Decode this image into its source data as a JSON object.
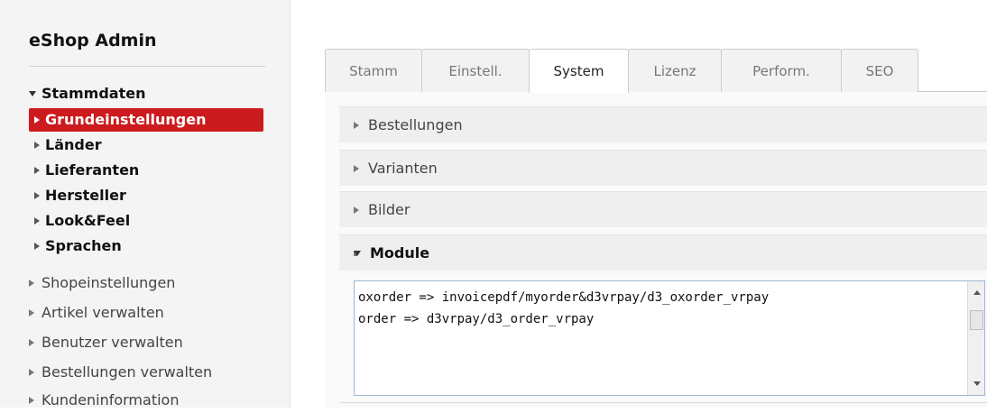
{
  "app": {
    "title": "eShop Admin"
  },
  "sidebar": {
    "group": {
      "label": "Stammdaten",
      "expanded": true
    },
    "subitems": [
      {
        "label": "Grundeinstellungen",
        "active": true
      },
      {
        "label": "Länder"
      },
      {
        "label": "Lieferanten"
      },
      {
        "label": "Hersteller"
      },
      {
        "label": "Look&Feel"
      },
      {
        "label": "Sprachen"
      }
    ],
    "items": [
      {
        "label": "Shopeinstellungen"
      },
      {
        "label": "Artikel verwalten"
      },
      {
        "label": "Benutzer verwalten"
      },
      {
        "label": "Bestellungen verwalten"
      },
      {
        "label": "Kundeninformation"
      }
    ]
  },
  "tabs": [
    {
      "label": "Stamm"
    },
    {
      "label": "Einstell."
    },
    {
      "label": "System",
      "active": true
    },
    {
      "label": "Lizenz"
    },
    {
      "label": "Perform."
    },
    {
      "label": "SEO"
    }
  ],
  "sections": [
    {
      "label": "Bestellungen",
      "expanded": false
    },
    {
      "label": "Varianten",
      "expanded": false
    },
    {
      "label": "Bilder",
      "expanded": false
    },
    {
      "label": "Module",
      "expanded": true
    }
  ],
  "module_config": {
    "lines": [
      "oxorder => invoicepdf/myorder&d3vrpay/d3_oxorder_vrpay",
      "order => d3vrpay/d3_order_vrpay"
    ]
  },
  "colors": {
    "active_nav": "#cc1b1e",
    "textarea_border": "#9fb7d4"
  }
}
